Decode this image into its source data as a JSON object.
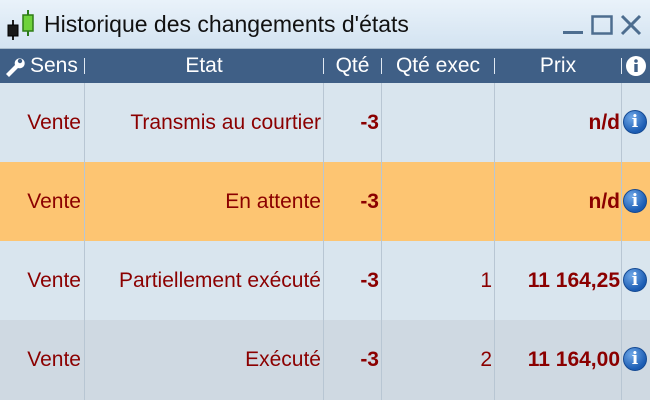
{
  "window": {
    "title": "Historique des changements d'états"
  },
  "table": {
    "columns": {
      "sens": "Sens",
      "etat": "Etat",
      "qte": "Qté",
      "qte_exec": "Qté exec",
      "prix": "Prix"
    },
    "rows": [
      {
        "sens": "Vente",
        "etat": "Transmis au courtier",
        "qte": "-3",
        "qte_exec": "",
        "prix": "n/d",
        "bg": "#d9e5ee"
      },
      {
        "sens": "Vente",
        "etat": "En attente",
        "qte": "-3",
        "qte_exec": "",
        "prix": "n/d",
        "bg": "#fdc572"
      },
      {
        "sens": "Vente",
        "etat": "Partiellement exécuté",
        "qte": "-3",
        "qte_exec": "1",
        "prix": "11 164,25",
        "bg": "#d9e5ee"
      },
      {
        "sens": "Vente",
        "etat": "Exécuté",
        "qte": "-3",
        "qte_exec": "2",
        "prix": "11 164,00",
        "bg": "#cfd9e2"
      }
    ]
  },
  "colors": {
    "header_bg": "#3f5f86",
    "text": "#8b0000",
    "highlight_row": "#fdc572"
  },
  "icons": {
    "app": "candlestick-chart-icon",
    "settings": "wrench-icon",
    "info_header": "info-icon",
    "row_info": "info-icon"
  }
}
